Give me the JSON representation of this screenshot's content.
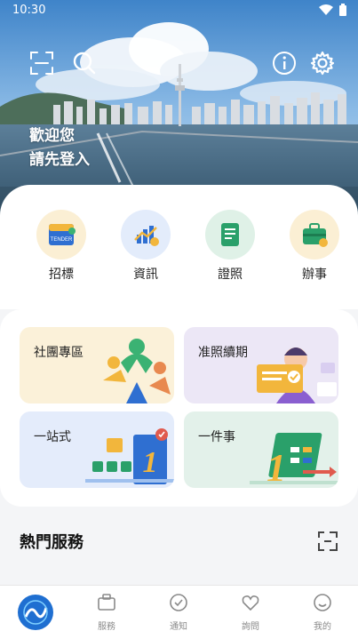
{
  "status_bar": {
    "time": "10:30"
  },
  "hero": {
    "welcome_line1": "歡迎您",
    "welcome_line2": "請先登入"
  },
  "quick_actions": [
    {
      "label": "招標",
      "badge": "TENDER"
    },
    {
      "label": "資訊"
    },
    {
      "label": "證照"
    },
    {
      "label": "辦事"
    }
  ],
  "tiles": [
    {
      "label": "社團專區"
    },
    {
      "label": "准照續期"
    },
    {
      "label": "一站式"
    },
    {
      "label": "一件事"
    }
  ],
  "section": {
    "title": "熱門服務"
  },
  "tabs": [
    {
      "label": "服務"
    },
    {
      "label": "通知"
    },
    {
      "label": "詢問"
    },
    {
      "label": "我的"
    }
  ],
  "colors": {
    "accent": "#1f6fd1",
    "tile_yellow": "#fbf1d9",
    "tile_purple": "#ece7f6",
    "tile_blue": "#e4ecfb",
    "tile_green": "#e3f1ea"
  }
}
